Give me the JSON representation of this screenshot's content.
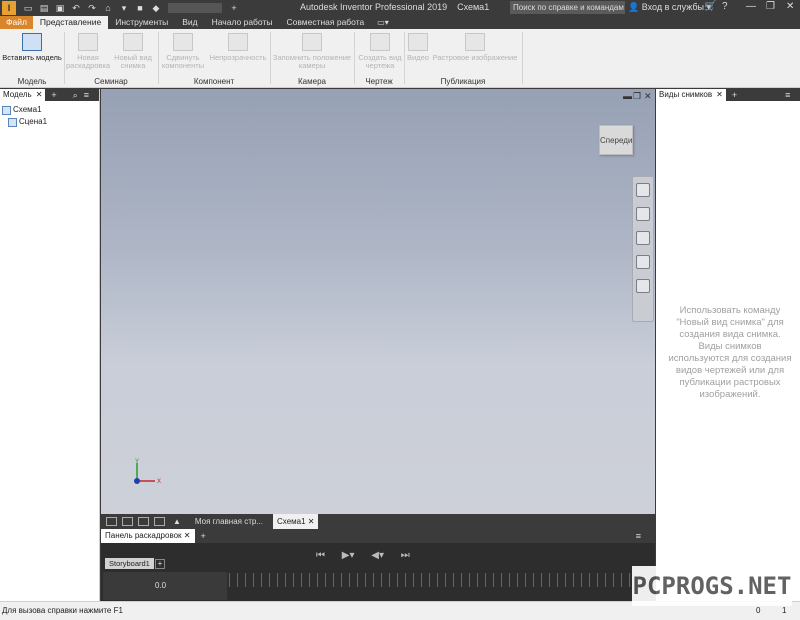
{
  "titlebar": {
    "app_logo": "I",
    "title": "Autodesk Inventor Professional 2019",
    "document": "Схема1",
    "search_placeholder": "Поиск по справке и командам",
    "signin": "Вход в службы"
  },
  "ribbon_tabs": [
    "Файл",
    "Представление",
    "Инструменты",
    "Вид",
    "Начало работы",
    "Совместная работа"
  ],
  "ribbon": {
    "insert_model": "Вставить модель",
    "new_storyboard": "Новая раскадровка",
    "new_snapshot": "Новый вид снимка",
    "move_components": "Сдвинуть компоненты",
    "opacity": "Непрозрачность",
    "capture_camera": "Запомнить положение камеры",
    "create_drawing_view": "Создать вид чертежа",
    "video": "Видео",
    "raster_image": "Растровое изображение",
    "groups": {
      "model": "Модель",
      "seminar": "Семинар",
      "component": "Компонент",
      "camera": "Камера",
      "drawing": "Чертеж",
      "publish": "Публикация"
    }
  },
  "left_panel": {
    "tab": "Модель",
    "tree": [
      "Схема1",
      "Сцена1"
    ]
  },
  "viewport": {
    "viewcube_label": "Спереди",
    "triad_x": "X",
    "triad_y": "Y"
  },
  "doc_tabs": [
    "Моя главная стр...",
    "Схема1"
  ],
  "storyboard": {
    "panel_tab": "Панель раскадровок",
    "sheet": "Storyboard1",
    "time": "0.0"
  },
  "right_panel": {
    "tab": "Виды снимков",
    "hint": "Использовать команду \"Новый вид снимка\" для создания вида снимка. Виды снимков используются для создания видов чертежей или для публикации растровых изображений."
  },
  "status": {
    "text": "Для вызова справки нажмите F1",
    "count1": "0",
    "count2": "1"
  },
  "watermark": "PCPROGS.NET",
  "colors": {
    "file_tab": "#d9852a",
    "dark_chrome": "#3b3b3b",
    "axis_x": "#c0282a",
    "axis_y": "#2a9a2a",
    "axis_z": "#2040b0"
  }
}
